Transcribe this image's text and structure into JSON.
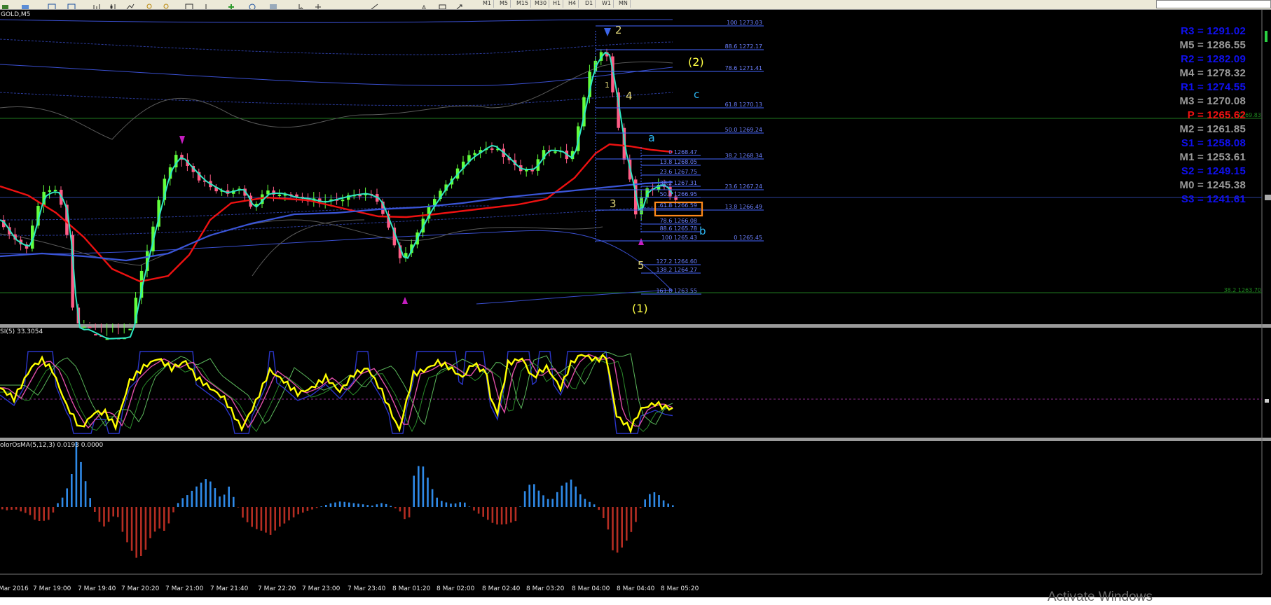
{
  "toolbar": {
    "timeframes": [
      "M1",
      "M5",
      "M15",
      "M30",
      "H1",
      "H4",
      "D1",
      "W1",
      "MN"
    ]
  },
  "main_chart": {
    "symbol_label": "GOLD,M5",
    "wave_labels": {
      "w2": "2",
      "w1": "1",
      "w4": "4",
      "w3": "3",
      "w5": "5",
      "wa": "a",
      "wb": "b",
      "wc": "c",
      "big2": "(2)",
      "big1": "(1)"
    },
    "fib_big": [
      {
        "text": "100 1273.03"
      },
      {
        "text": "88.6 1272.17"
      },
      {
        "text": "78.6 1271.41"
      },
      {
        "text": "61.8 1270.13"
      },
      {
        "text": "50.0 1269.24"
      },
      {
        "text": "38.2 1268.34"
      },
      {
        "text": "23.6 1267.24"
      },
      {
        "text": "13.8 1266.49"
      },
      {
        "text": "0 1265.45"
      }
    ],
    "fib_small": [
      {
        "text": "0 1268.47"
      },
      {
        "text": "13.8 1268.05"
      },
      {
        "text": "23.6 1267.75"
      },
      {
        "text": "38.2 1267.31"
      },
      {
        "text": "50.0 1266.95"
      },
      {
        "text": "61.8 1266.59"
      },
      {
        "text": "78.6 1266.08"
      },
      {
        "text": "88.6 1265.78"
      },
      {
        "text": "100 1265.43"
      },
      {
        "text": "127.2 1264.60"
      },
      {
        "text": "138.2 1264.27"
      },
      {
        "text": "161.8 1263.55"
      }
    ],
    "right_labels": {
      "top": "1269.83",
      "bottom": "38.2 1263.70"
    }
  },
  "pivots": [
    {
      "label": "R3 = 1291.02",
      "color": "#1010ee"
    },
    {
      "label": "M5 = 1286.55",
      "color": "#9a9a9a"
    },
    {
      "label": "R2 = 1282.09",
      "color": "#1010ee"
    },
    {
      "label": "M4 = 1278.32",
      "color": "#9a9a9a"
    },
    {
      "label": "R1 = 1274.55",
      "color": "#1010ee"
    },
    {
      "label": "M3 = 1270.08",
      "color": "#9a9a9a"
    },
    {
      "label": "P   = 1265.62",
      "color": "#ee1111"
    },
    {
      "label": "M2 = 1261.85",
      "color": "#9a9a9a"
    },
    {
      "label": "S1 = 1258.08",
      "color": "#1010ee"
    },
    {
      "label": "M1 = 1253.61",
      "color": "#9a9a9a"
    },
    {
      "label": "S2 = 1249.15",
      "color": "#1010ee"
    },
    {
      "label": "M0 = 1245.38",
      "color": "#9a9a9a"
    },
    {
      "label": "S3 = 1241.61",
      "color": "#1010ee"
    }
  ],
  "rsi_panel": {
    "title": "SI(5) 33.3054"
  },
  "osma_panel": {
    "title": "olorOsMA(5,12,3) 0.0193 0.0000"
  },
  "time_axis": [
    "Mar 2016",
    "7 Mar 19:00",
    "7 Mar 19:40",
    "7 Mar 20:20",
    "7 Mar 21:00",
    "7 Mar 21:40",
    "7 Mar 22:20",
    "7 Mar 23:00",
    "7 Mar 23:40",
    "8 Mar 01:20",
    "8 Mar 02:00",
    "8 Mar 02:40",
    "8 Mar 03:20",
    "8 Mar 04:00",
    "8 Mar 04:40",
    "8 Mar 05:20"
  ],
  "watermark": "Activate Windows",
  "colors": {
    "bull": "#62ff3c",
    "bear": "#ff5d86",
    "ema_red": "#ee1111",
    "ma_blue": "#3a55d8",
    "fast_ma": "#2fe7c3",
    "rsi": "#ffff00",
    "osma_up": "#2f8ae8",
    "osma_down": "#b52d22",
    "fib": "#4466ff"
  }
}
